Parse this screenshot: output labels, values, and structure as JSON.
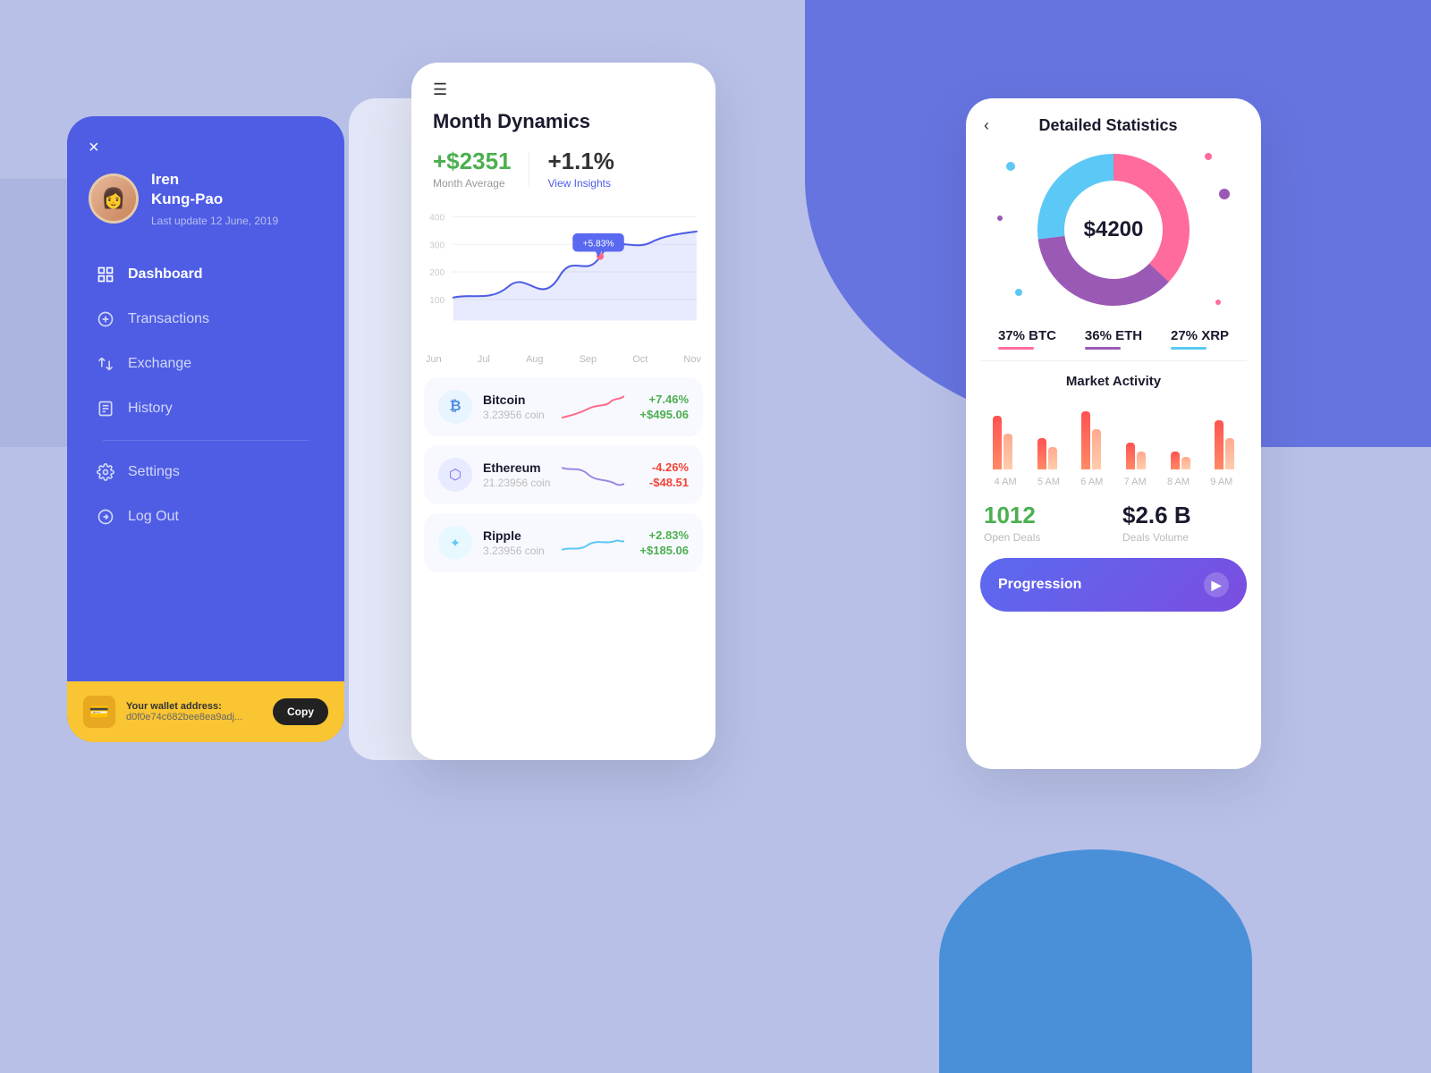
{
  "background": {
    "color": "#b8c0e8",
    "blob_color": "#6674e0",
    "blob2_color": "#4a90d9"
  },
  "left_panel": {
    "close_label": "×",
    "user": {
      "name_line1": "Iren",
      "name_line2": "Kung-Pao",
      "last_update": "Last update 12 June, 2019"
    },
    "nav_items": [
      {
        "id": "dashboard",
        "label": "Dashboard",
        "active": true
      },
      {
        "id": "transactions",
        "label": "Transactions",
        "active": false
      },
      {
        "id": "exchange",
        "label": "Exchange",
        "active": false
      },
      {
        "id": "history",
        "label": "History",
        "active": false
      },
      {
        "id": "settings",
        "label": "Settings",
        "active": false
      },
      {
        "id": "logout",
        "label": "Log Out",
        "active": false
      }
    ],
    "wallet": {
      "label": "Your wallet address:",
      "address": "d0f0e74c682bee8ea9adj...",
      "copy_label": "Copy"
    }
  },
  "mid_panel": {
    "menu_icon": "☰",
    "title": "Month Dynamics",
    "month_avg_value": "+$2351",
    "month_avg_label": "Month Average",
    "insight_value": "+1.1%",
    "insight_label": "View Insights",
    "chart_tooltip": "+5.83%",
    "chart_x_labels": [
      "Jun",
      "Jul",
      "Aug",
      "Sep",
      "Oct",
      "Nov"
    ],
    "chart_y_labels": [
      "400",
      "300",
      "200",
      "100"
    ],
    "crypto_items": [
      {
        "id": "btc",
        "name": "Bitcoin",
        "coin": "3.23956 coin",
        "pct": "+7.46%",
        "pct_positive": true,
        "usd": "+$495.06",
        "usd_positive": true,
        "symbol": "₿"
      },
      {
        "id": "eth",
        "name": "Ethereum",
        "coin": "21.23956 coin",
        "pct": "-4.26%",
        "pct_positive": false,
        "usd": "-$48.51",
        "usd_positive": false,
        "symbol": "⬡"
      },
      {
        "id": "xrp",
        "name": "Ripple",
        "coin": "3.23956 coin",
        "pct": "+2.83%",
        "pct_positive": true,
        "usd": "+$185.06",
        "usd_positive": true,
        "symbol": "✦"
      }
    ]
  },
  "right_panel": {
    "back_label": "‹",
    "title": "Detailed Statistics",
    "donut_center": "$4200",
    "legend": [
      {
        "pct": "37% BTC",
        "color": "#ff6b9d"
      },
      {
        "pct": "36% ETH",
        "color": "#9b59b6"
      },
      {
        "pct": "27% XRP",
        "color": "#5bc8f5"
      }
    ],
    "market_title": "Market Activity",
    "bar_labels": [
      "4 AM",
      "5 AM",
      "6 AM",
      "7 AM",
      "8 AM",
      "9 AM"
    ],
    "bars": [
      [
        60,
        40
      ],
      [
        35,
        25
      ],
      [
        65,
        45
      ],
      [
        30,
        20
      ],
      [
        20,
        15
      ],
      [
        55,
        35
      ]
    ],
    "open_deals_value": "1012",
    "open_deals_label": "Open Deals",
    "deals_volume_value": "$2.6 B",
    "deals_volume_label": "Deals Volume",
    "progression_label": "Progression"
  }
}
